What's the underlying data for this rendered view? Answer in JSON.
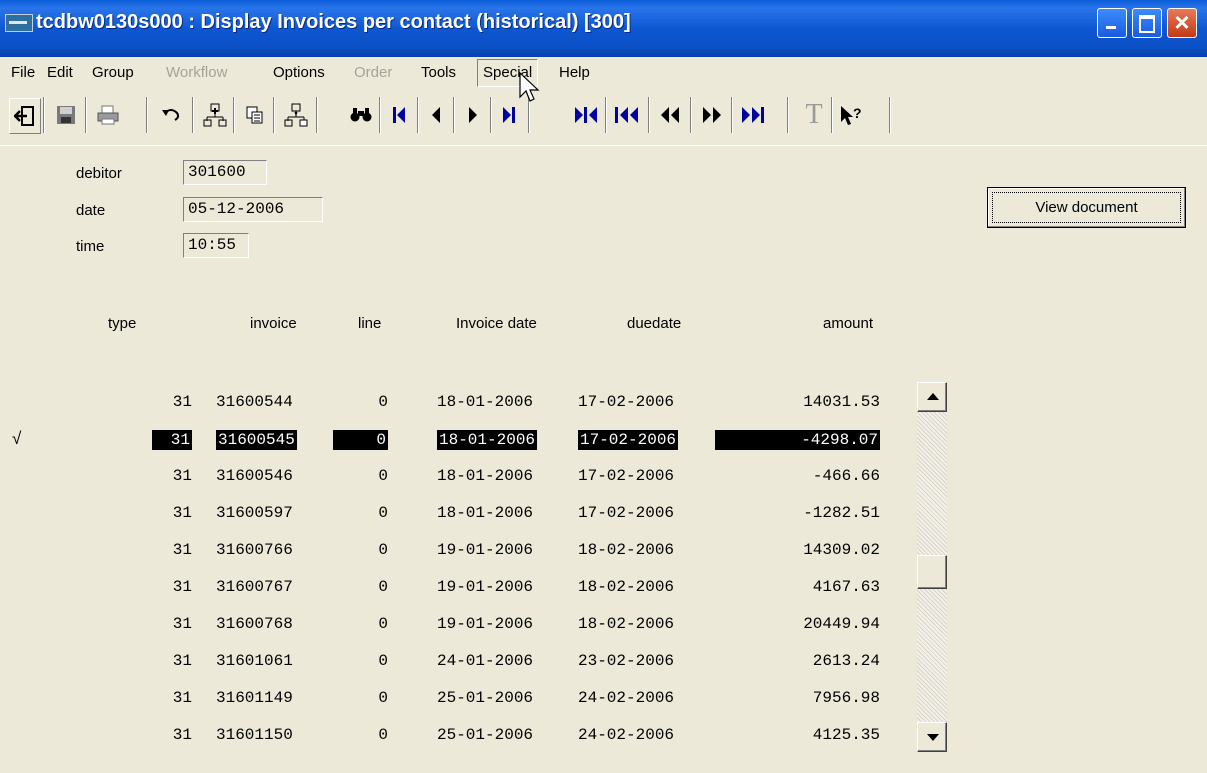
{
  "window": {
    "title": "tcdbw0130s000 : Display Invoices per contact (historical) [300]"
  },
  "menu": [
    {
      "label": "File",
      "disabled": false
    },
    {
      "label": "Edit",
      "disabled": false
    },
    {
      "label": "Group",
      "disabled": false
    },
    {
      "label": "Workflow",
      "disabled": true
    },
    {
      "label": "Options",
      "disabled": false
    },
    {
      "label": "Order",
      "disabled": true
    },
    {
      "label": "Tools",
      "disabled": false
    },
    {
      "label": "Special",
      "disabled": false,
      "pressed": true
    },
    {
      "label": "Help",
      "disabled": false
    }
  ],
  "toolbar": {
    "icons": [
      "exit-icon",
      "save-icon",
      "print-icon",
      "undo-icon",
      "insert-icon",
      "copy-icon",
      "duplicate-icon",
      "find-icon",
      "first-record-icon",
      "previous-record-icon",
      "next-record-icon",
      "last-record-icon",
      "first-set-icon",
      "first-page-icon",
      "previous-page-icon",
      "next-page-icon",
      "last-page-icon",
      "text-icon",
      "help-icon"
    ]
  },
  "form": {
    "debitor_label": "debitor",
    "debitor_value": "301600",
    "date_label": "date",
    "date_value": "05-12-2006",
    "time_label": "time",
    "time_value": "10:55",
    "view_document_label": "View document"
  },
  "table": {
    "headers": {
      "type": "type",
      "invoice": "invoice",
      "line": "line",
      "invoice_date": "Invoice date",
      "duedate": "duedate",
      "amount": "amount"
    },
    "rows": [
      {
        "type": "31",
        "invoice": "31600544",
        "line": "0",
        "invoice_date": "18-01-2006",
        "duedate": "17-02-2006",
        "amount": "14031.53"
      },
      {
        "type": "31",
        "invoice": "31600545",
        "line": "0",
        "invoice_date": "18-01-2006",
        "duedate": "17-02-2006",
        "amount": "-4298.07",
        "selected": true,
        "mark": "√"
      },
      {
        "type": "31",
        "invoice": "31600546",
        "line": "0",
        "invoice_date": "18-01-2006",
        "duedate": "17-02-2006",
        "amount": "-466.66"
      },
      {
        "type": "31",
        "invoice": "31600597",
        "line": "0",
        "invoice_date": "18-01-2006",
        "duedate": "17-02-2006",
        "amount": "-1282.51"
      },
      {
        "type": "31",
        "invoice": "31600766",
        "line": "0",
        "invoice_date": "19-01-2006",
        "duedate": "18-02-2006",
        "amount": "14309.02"
      },
      {
        "type": "31",
        "invoice": "31600767",
        "line": "0",
        "invoice_date": "19-01-2006",
        "duedate": "18-02-2006",
        "amount": "4167.63"
      },
      {
        "type": "31",
        "invoice": "31600768",
        "line": "0",
        "invoice_date": "19-01-2006",
        "duedate": "18-02-2006",
        "amount": "20449.94"
      },
      {
        "type": "31",
        "invoice": "31601061",
        "line": "0",
        "invoice_date": "24-01-2006",
        "duedate": "23-02-2006",
        "amount": "2613.24"
      },
      {
        "type": "31",
        "invoice": "31601149",
        "line": "0",
        "invoice_date": "25-01-2006",
        "duedate": "24-02-2006",
        "amount": "7956.98"
      },
      {
        "type": "31",
        "invoice": "31601150",
        "line": "0",
        "invoice_date": "25-01-2006",
        "duedate": "24-02-2006",
        "amount": "4125.35"
      }
    ]
  }
}
